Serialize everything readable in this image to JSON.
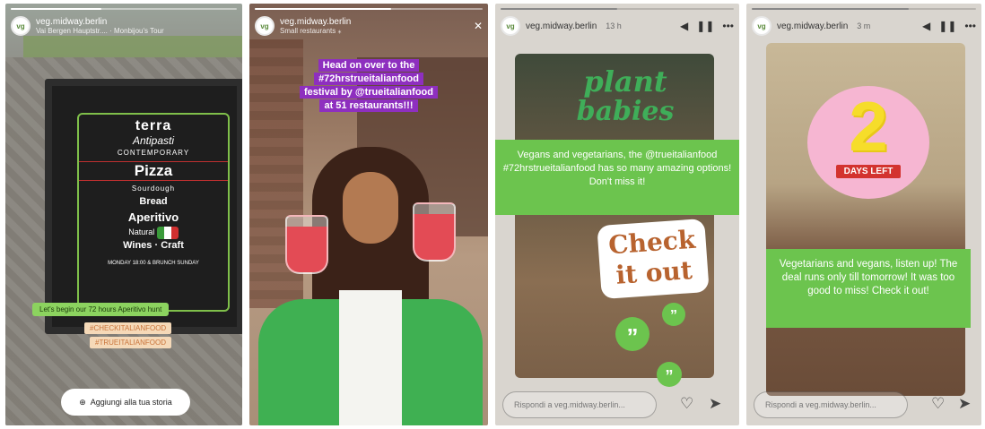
{
  "stories": [
    {
      "username": "veg.midway.berlin",
      "subtitle": "Vai Bergen Hauptstr.... · Monbijou's Tour",
      "board": {
        "brand": "terra",
        "line1": "Antipasti",
        "line2": "CONTEMPORARY",
        "line3": "Pizza",
        "line4": "Sourdough",
        "line5": "Bread",
        "line6": "Aperitivo",
        "line7": "Natural",
        "line8": "Wines",
        "line9": "Craft",
        "line10": "MONDAY 18:00 & BRUNCH SUNDAY"
      },
      "caption": "Let's begin our 72 hours Aperitivo hunt",
      "tags": [
        "#CHECKITALIANFOOD",
        "#TRUEITALIANFOOD"
      ],
      "add_story": "Aggiungi alla tua storia"
    },
    {
      "username": "veg.midway.berlin",
      "subtitle": "Small restaurants ⁎",
      "caption_lines": [
        "Head on over to the",
        "#72hrstrueitalianfood",
        "festival by @trueitalianfood",
        "at 51 restaurants!!!"
      ]
    },
    {
      "username": "veg.midway.berlin",
      "time": "13 h",
      "sticker_line1": "plant",
      "sticker_line2": "babies",
      "text": "Vegans and vegetarians, the @trueitalianfood #72hrstrueitalianfood has so many amazing options! Don't miss it!",
      "check_line1": "Check",
      "check_line2": "it out",
      "reply_placeholder": "Rispondi a veg.midway.berlin..."
    },
    {
      "username": "veg.midway.berlin",
      "time": "3 m",
      "countdown_number": "2",
      "countdown_label": "DAYS LEFT",
      "text": "Vegetarians and vegans, listen up! The deal runs only till tomorrow! It was too good to miss!  Check it out!",
      "reply_placeholder": "Rispondi a veg.midway.berlin..."
    }
  ],
  "colors": {
    "accent_green": "#6cc44e",
    "caption_purple": "#8e2fbf",
    "countdown_pink": "#f6b6d2",
    "countdown_yellow": "#f6dd2a"
  },
  "icons": {
    "header": [
      "volume-icon",
      "pause-icon",
      "more-icon"
    ],
    "footer": [
      "heart-icon",
      "send-icon"
    ]
  }
}
